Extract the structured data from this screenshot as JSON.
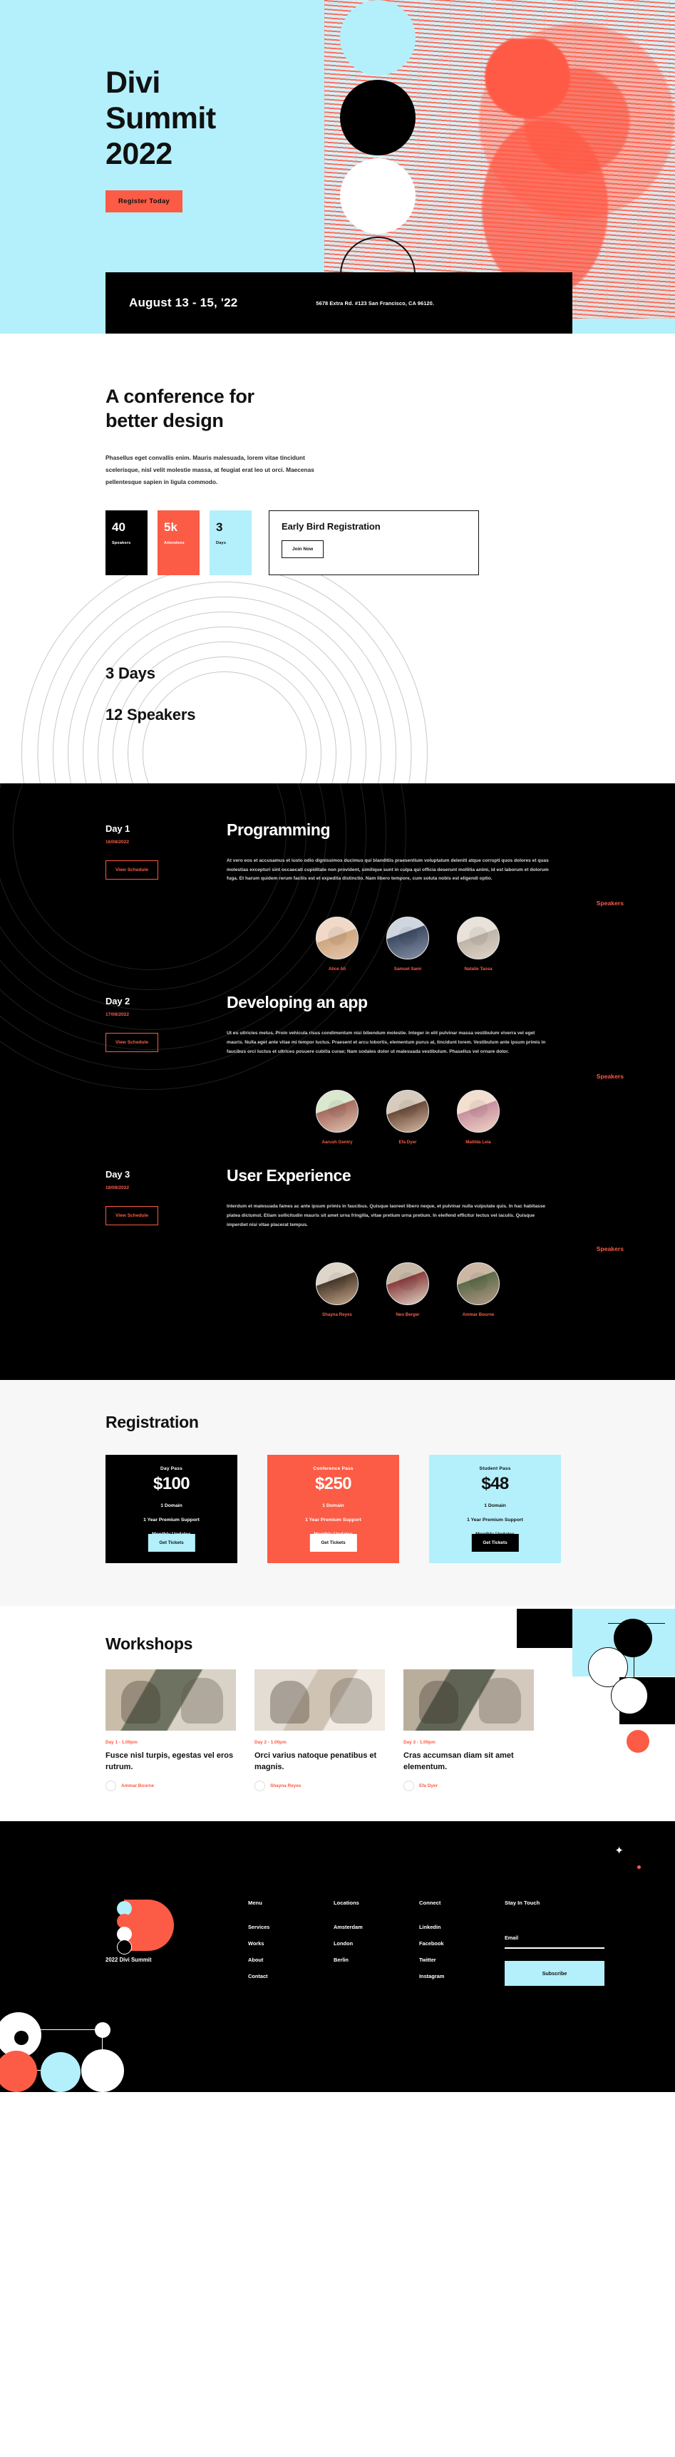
{
  "hero": {
    "title": "Divi Summit 2022",
    "title_lines": [
      "Divi",
      "Summit",
      "2022"
    ],
    "register_label": "Register Today",
    "date": "August 13 - 15, '22",
    "address": "5678 Extra Rd. #123 San Francisco, CA 96120.",
    "colors": {
      "cyan": "#b3f0fb",
      "coral": "#fc5b45",
      "black": "#000000"
    }
  },
  "conference": {
    "heading_lines": [
      "A conference for",
      "better design"
    ],
    "paragraph": "Phasellus eget convallis enim. Mauris malesuada, lorem vitae tincidunt scelerisque, nisl velit molestie massa, at feugiat erat leo ut orci. Maecenas pellentesque sapien in ligula commodo.",
    "stats": [
      {
        "value": "40",
        "label": "Speakers"
      },
      {
        "value": "5k",
        "label": "Attendees"
      },
      {
        "value": "3",
        "label": "Days"
      }
    ],
    "early_bird": {
      "title": "Early Bird Registration",
      "cta": "Join Now"
    }
  },
  "rings": {
    "line1": "3 Days",
    "line2": "12 Speakers"
  },
  "program": {
    "speakers_label": "Speakers",
    "schedule_label": "View Schedule",
    "days": [
      {
        "day": "Day 1",
        "date": "16/08/2022",
        "title": "Programming",
        "text": "At vero eos et accusamus et iusto odio dignissimos ducimus qui blanditiis praesentium voluptatum deleniti atque corrupti quos dolores et quas molestias excepturi sint occaecati cupiditate non provident, similique sunt in culpa qui officia deserunt mollitia animi, id est laborum et dolorum fuga. Et harum quidem rerum facilis est et expedita distinctio. Nam libero tempore, cum soluta nobis est eligendi optio.",
        "speakers": [
          "Alice Ali",
          "Samuel Sami",
          "Natalie Tassa"
        ]
      },
      {
        "day": "Day 2",
        "date": "17/08/2022",
        "title": "Developing an app",
        "text": "Ut eu ultricies metus. Proin vehicula risus condimentum nisi bibendum molestie. Integer in elit pulvinar massa vestibulum viverra vel eget mauris. Nulla eget ante vitae mi tempor luctus. Praesent et arcu lobortis, elementum purus at, tincidunt lorem. Vestibulum ante ipsum primis in faucibus orci luctus et ultrices posuere cubilia curae; Nam sodales dolor ut malesuada vestibulum. Phasellus vel ornare dolor.",
        "speakers": [
          "Aarush Gentry",
          "Efa Dyer",
          "Matilda Leia"
        ]
      },
      {
        "day": "Day 3",
        "date": "18/08/2022",
        "title": "User Experience",
        "text": "Interdum et malesuada fames ac ante ipsum primis in faucibus. Quisque laoreet libero neque, et pulvinar nulla vulputate quis. In hac habitasse platea dictumst. Etiam sollicitudin mauris sit amet urna fringilla, vitae pretium urna pretium. In eleifend efficitur lectus vel iaculis. Quisque imperdiet nisi vitae placerat tempus.",
        "speakers": [
          "Shayna Reyes",
          "Neo Berger",
          "Ammar Bourne"
        ]
      }
    ]
  },
  "registration": {
    "heading": "Registration",
    "plans": [
      {
        "name": "Day Pass",
        "price": "$100",
        "features": [
          "1 Domain",
          "1 Year Premium Support",
          "Monthly Updates"
        ],
        "cta": "Get Tickets"
      },
      {
        "name": "Conference Pass",
        "price": "$250",
        "features": [
          "1 Domain",
          "1 Year Premium Support",
          "Monthly Updates"
        ],
        "cta": "Get Tickets"
      },
      {
        "name": "Student Pass",
        "price": "$48",
        "features": [
          "1 Domain",
          "1 Year Premium Support",
          "Monthly Updates"
        ],
        "cta": "Get Tickets"
      }
    ]
  },
  "workshops": {
    "heading": "Workshops",
    "cards": [
      {
        "meta": "Day 1 - 1.00pm",
        "title": "Fusce nisl turpis, egestas vel eros rutrum.",
        "author": "Ammar Bourne"
      },
      {
        "meta": "Day 2 - 1.00pm",
        "title": "Orci varius natoque penatibus et magnis.",
        "author": "Shayna Reyes"
      },
      {
        "meta": "Day 3 - 1.00pm",
        "title": "Cras accumsan diam sit amet elementum.",
        "author": "Efa Dyer"
      }
    ]
  },
  "footer": {
    "brand_name": "2022 Divi Summit",
    "columns": [
      {
        "heading": "Menu",
        "links": [
          "Services",
          "Works",
          "About",
          "Contact"
        ]
      },
      {
        "heading": "Locations",
        "links": [
          "Amsterdam",
          "London",
          "Berlin"
        ]
      },
      {
        "heading": "Connect",
        "links": [
          "Linkedin",
          "Facebook",
          "Twitter",
          "Instagram"
        ]
      }
    ],
    "newsletter": {
      "heading": "Stay In Touch",
      "label": "Email",
      "value": "",
      "placeholder": "",
      "button": "Subscribe"
    },
    "sparkle_icon": "sparkle-icon"
  }
}
